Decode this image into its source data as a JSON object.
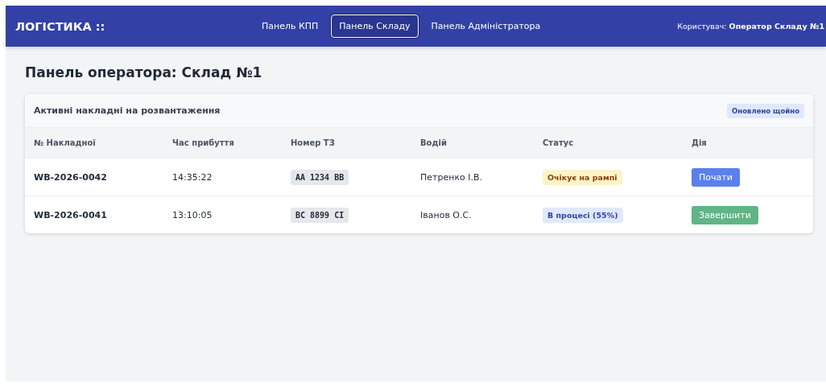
{
  "header": {
    "logo": "ЛОГІСТИКА ::",
    "nav": [
      {
        "label": "Панель КПП",
        "selected": false
      },
      {
        "label": "Панель Складу",
        "selected": true
      },
      {
        "label": "Панель Адміністратора",
        "selected": false
      }
    ],
    "user_label": "Користувач:",
    "user_name": "Оператор Складу №1"
  },
  "page_title": "Панель оператора: Склад №1",
  "card": {
    "title": "Активні накладні на розвантаження",
    "badge": "Оновлено щойно",
    "table": {
      "columns": [
        "№ Накладної",
        "Час прибуття",
        "Номер ТЗ",
        "Водій",
        "Статус",
        "Дія"
      ],
      "rows": [
        {
          "waybill": "WB-2026-0042",
          "arrival": "14:35:22",
          "plate": "AA 1234 BB",
          "driver": "Петренко І.В.",
          "status": {
            "kind": "waiting",
            "label": "Очікує на рампі"
          },
          "action": {
            "kind": "start",
            "label": "Почати"
          }
        },
        {
          "waybill": "WB-2026-0041",
          "arrival": "13:10:05",
          "plate": "BC 8899 CI",
          "driver": "Іванов О.С.",
          "status": {
            "kind": "progress",
            "label": "В процесі (55%)"
          },
          "action": {
            "kind": "finish",
            "label": "Завершити"
          }
        }
      ]
    }
  }
}
